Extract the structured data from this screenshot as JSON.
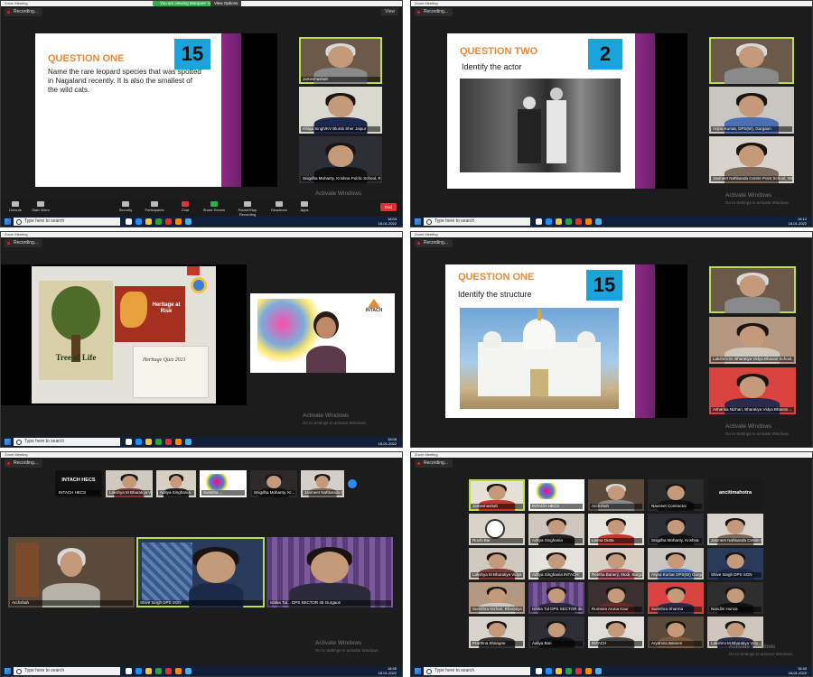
{
  "common": {
    "window_title": "Zoom Meeting",
    "recording": "Recording...",
    "taskbar_search": "Type here to search",
    "watermark_title": "Activate Windows",
    "watermark_sub": "Go to Settings to activate Windows.",
    "tray_lang": "ENG"
  },
  "panel1": {
    "share_banner": "You are viewing Marquee' screen",
    "view_options": "View Options",
    "view_label": "View",
    "slide_title": "QUESTION ONE",
    "slide_number": "15",
    "slide_text": "Name the rare leopard species that was spotted in Nagaland recently. It is also the smallest of the wild cats.",
    "participants": [
      {
        "name": "Jameshashah"
      },
      {
        "name": "Ishiqa Singh/KV Blumb Sher Jaipur"
      },
      {
        "name": "Snigdha Mohanty, Krishna Public School, Ra..."
      }
    ],
    "toolbar": [
      {
        "label": "Unmute",
        "icon": "mic-icon"
      },
      {
        "label": "Start Video",
        "icon": "video-icon"
      },
      {
        "label": "Security",
        "icon": "shield-icon"
      },
      {
        "label": "Participants",
        "icon": "participants-icon",
        "count": "26"
      },
      {
        "label": "Chat",
        "icon": "chat-icon"
      },
      {
        "label": "Share Screen",
        "icon": "share-icon"
      },
      {
        "label": "Pause/Stop Recording",
        "icon": "record-icon"
      },
      {
        "label": "Reactions",
        "icon": "reaction-icon"
      },
      {
        "label": "Apps",
        "icon": "apps-icon"
      }
    ],
    "end_label": "End",
    "time": "16:03",
    "date": "18-01-2022"
  },
  "panel2": {
    "slide_title": "QUESTION TWO",
    "slide_number": "2",
    "slide_text": "Identify the actor",
    "participants": [
      {
        "name": ""
      },
      {
        "name": "Anjna Kumar, DPS(W), Gurgaon"
      },
      {
        "name": "Jasmeet Nahbanda Centre Point School, Wardh..."
      }
    ],
    "time": "16:12",
    "date": "18-01-2022"
  },
  "panel3": {
    "poster_tree": "Tree of Life",
    "poster_heritage": "Heritage at Risk",
    "poster_quiz": "Heritage Quiz 2021",
    "logo": "INTACH",
    "time": "16:08",
    "date": "18-01-2022"
  },
  "panel4": {
    "slide_title": "QUESTION ONE",
    "slide_number": "15",
    "slide_text": "Identify the structure",
    "participants": [
      {
        "name": ""
      },
      {
        "name": "Lakshmi M. Bharatiya Vidya Bhavan School..."
      },
      {
        "name": "Asharika Nizhari, Bharatiya Vidya Bhavan..."
      }
    ]
  },
  "panel5": {
    "top_strip": [
      {
        "name": "INTACH HECS",
        "card": "INTACH HECS"
      },
      {
        "name": "Lakshya M Bharatiya Vidy..."
      },
      {
        "name": "Aditya Singhania"
      },
      {
        "name": "Sumitha ..."
      },
      {
        "name": "Snigdha Mohanty, Kr..."
      },
      {
        "name": "Jasmeet Nahbanda Centr..."
      }
    ],
    "main": [
      {
        "name": "Archshah"
      },
      {
        "name": "Shive Singh DPS SGN"
      },
      {
        "name": "Ishika Tul... DPS SECTOR 45 Gurgaon"
      }
    ],
    "time": "16:45",
    "date": "18-01-2022"
  },
  "panel6": {
    "grid": [
      "Jameshashah",
      "INTACH HECS",
      "Archshah",
      "Navneet Contractor",
      "ancitimahotra",
      "Ruchi Bar",
      "Aditya Singhania",
      "Leena Dutta",
      "Snigdha Mohanty, Krishna",
      "Jasmeet Nahbanda Centre Poi...",
      "Lakshya M Bharatiya Vidya Bhavan",
      "Aditya Singhania INTACH",
      "Reetha Banerji, Modi, Burgun",
      "Anjna Kumar DPS(W) Gurgaon",
      "Shive Singh DPS SGN",
      "Sumithra Nizhari, Bharatiya",
      "Ishika Tul DPS SECTOR 45",
      "Rumeea Aruna Kaur",
      "Sumithra Sharma",
      "Nandini Hunza",
      "Prarthna Shangne",
      "Aaliya Bari",
      "INTACH",
      "Aryahina Bansen",
      "Lakshmi M Bharatiya Vidy..."
    ],
    "name_card": "ancitimahotra",
    "time": "16:45",
    "date": "18-01-2022"
  },
  "colors": {
    "slide_accent": "#1ba3dc",
    "slide_title": "#e8893a",
    "slide_bar": "#8c2b87",
    "active_speaker": "#b7e04b",
    "end_button": "#e0312f"
  }
}
